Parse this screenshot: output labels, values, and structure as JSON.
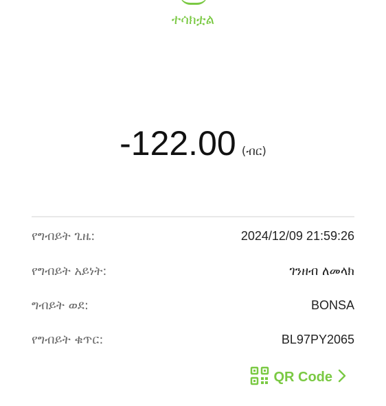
{
  "header": {
    "status_text": "ተሳክቷል"
  },
  "amount": {
    "value": "-122.00",
    "currency": "(ብር)"
  },
  "details": [
    {
      "label": "የግብይት ጊዜ:",
      "value": "2024/12/09 21:59:26"
    },
    {
      "label": "የግብይት አይነት:",
      "value": "ገንዘብ ለመላክ"
    },
    {
      "label": "ግብይት ወደ:",
      "value": "BONSA"
    },
    {
      "label": "የግብይት ቁጥር:",
      "value": "BL97PY2065"
    }
  ],
  "qr": {
    "label": "QR Code",
    "icon": "qr-code-icon",
    "chevron_icon": "chevron-right-icon"
  },
  "colors": {
    "accent": "#7ac943"
  }
}
